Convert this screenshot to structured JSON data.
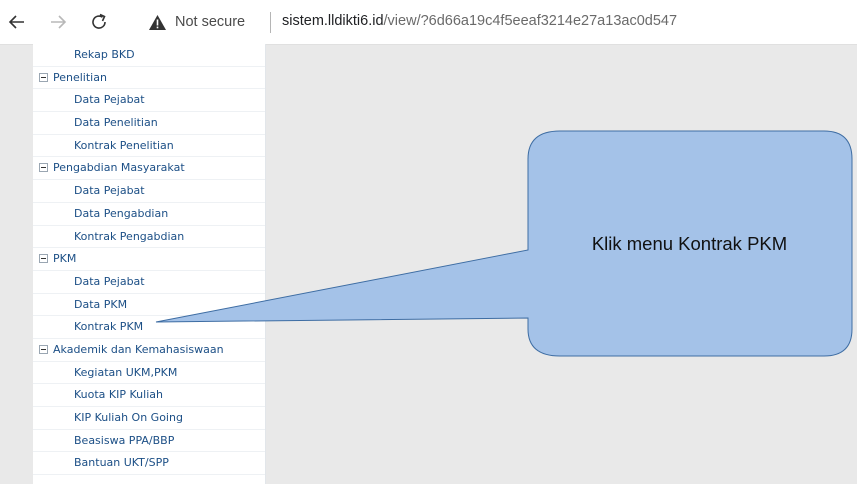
{
  "browser": {
    "security_label": "Not secure",
    "url_host": "sistem.lldikti6.id",
    "url_path": "/view/?6d66a19c4f5eeaf3214e27a13ac0d547"
  },
  "menu": {
    "rows": [
      {
        "type": "item",
        "label": "Rekap BKD"
      },
      {
        "type": "group",
        "label": "Penelitian"
      },
      {
        "type": "item",
        "label": "Data Pejabat"
      },
      {
        "type": "item",
        "label": "Data Penelitian"
      },
      {
        "type": "item",
        "label": "Kontrak Penelitian"
      },
      {
        "type": "group",
        "label": "Pengabdian Masyarakat"
      },
      {
        "type": "item",
        "label": "Data Pejabat"
      },
      {
        "type": "item",
        "label": "Data Pengabdian"
      },
      {
        "type": "item",
        "label": "Kontrak Pengabdian"
      },
      {
        "type": "group",
        "label": "PKM"
      },
      {
        "type": "item",
        "label": "Data Pejabat"
      },
      {
        "type": "item",
        "label": "Data PKM"
      },
      {
        "type": "item",
        "label": "Kontrak PKM"
      },
      {
        "type": "group",
        "label": "Akademik dan Kemahasiswaan"
      },
      {
        "type": "item",
        "label": "Kegiatan UKM,PKM"
      },
      {
        "type": "item",
        "label": "Kuota KIP Kuliah"
      },
      {
        "type": "item",
        "label": "KIP Kuliah On Going"
      },
      {
        "type": "item",
        "label": "Beasiswa PPA/BBP"
      },
      {
        "type": "item",
        "label": "Bantuan UKT/SPP"
      }
    ]
  },
  "callout": {
    "text": "Klik menu Kontrak PKM"
  },
  "colors": {
    "menu_link": "#1c4f86",
    "callout_fill": "#a4c2e8",
    "callout_stroke": "#3e6da3",
    "warning": "#333333"
  },
  "icons": [
    "back-arrow-icon",
    "forward-arrow-icon",
    "reload-icon",
    "warning-triangle-icon",
    "collapse-minus-icon"
  ]
}
